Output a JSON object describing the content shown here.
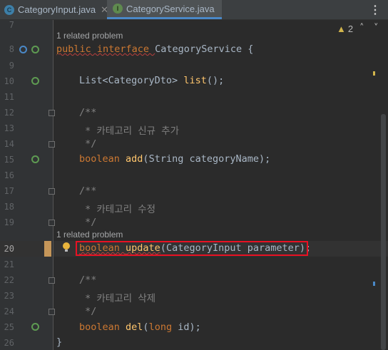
{
  "tabs": [
    {
      "label": "CategoryInput.java",
      "icon": "class-icon",
      "letter": "C"
    },
    {
      "label": "CategoryService.java",
      "icon": "interface-icon",
      "letter": "I",
      "active": true
    }
  ],
  "inspection": {
    "warning_count": "2"
  },
  "inlays": {
    "related_problem_1": "1 related problem",
    "related_problem_2": "1 related problem"
  },
  "lines": {
    "l7": "7",
    "l8": "8",
    "l9": "9",
    "l10": "10",
    "l11": "11",
    "l12": "12",
    "l13": "13",
    "l14": "14",
    "l15": "15",
    "l16": "16",
    "l17": "17",
    "l18": "18",
    "l19": "19",
    "l20": "20",
    "l21": "21",
    "l22": "22",
    "l23": "23",
    "l24": "24",
    "l25": "25",
    "l26": "26"
  },
  "code": {
    "l8_kw": "public interface ",
    "l8_name": "CategoryService ",
    "l8_brace": "{",
    "l10_type": "List<CategoryDto> ",
    "l10_fn": "list",
    "l10_rest": "();",
    "l12": "/**",
    "l13": " * 카테고리 신규 추가",
    "l14": " */",
    "l15_kw": "boolean ",
    "l15_fn": "add",
    "l15_open": "(",
    "l15_type": "String ",
    "l15_param": "categoryName",
    "l15_close": ");",
    "l17": "/**",
    "l18": " * 카테고리 수정",
    "l19": " */",
    "l20_kw": "boolean ",
    "l20_fn": "update",
    "l20_open": "(",
    "l20_type": "CategoryInput ",
    "l20_param": "parameter",
    "l20_close": ");",
    "l22": "/**",
    "l23": " * 카테고리 삭제",
    "l24": " */",
    "l25_kw": "boolean ",
    "l25_fn": "del",
    "l25_open": "(",
    "l25_type": "long ",
    "l25_param": "id",
    "l25_close": ");",
    "l26": "}"
  },
  "colors": {
    "keyword": "#cc7832",
    "method": "#ffc66d",
    "comment": "#808080",
    "highlight_box": "#e81123"
  }
}
